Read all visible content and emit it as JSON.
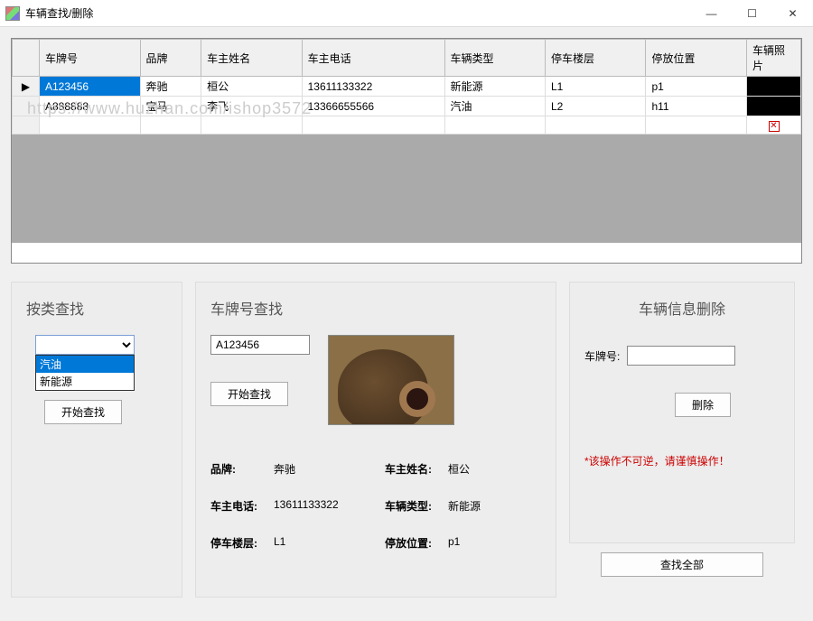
{
  "window": {
    "title": "车辆查找/删除"
  },
  "grid": {
    "columns": [
      "车牌号",
      "品牌",
      "车主姓名",
      "车主电话",
      "车辆类型",
      "停车楼层",
      "停放位置",
      "车辆照片"
    ],
    "rows": [
      {
        "plate": "A123456",
        "brand": "奔驰",
        "owner": "桓公",
        "phone": "13611133322",
        "type": "新能源",
        "floor": "L1",
        "pos": "p1"
      },
      {
        "plate": "A888888",
        "brand": "宝马",
        "owner": "李飞",
        "phone": "13366655566",
        "type": "汽油",
        "floor": "L2",
        "pos": "h11"
      }
    ]
  },
  "categorySearch": {
    "title": "按类查找",
    "options": [
      "汽油",
      "新能源"
    ],
    "buttonLabel": "开始查找"
  },
  "plateSearch": {
    "title": "车牌号查找",
    "inputValue": "A123456",
    "buttonLabel": "开始查找",
    "labels": {
      "brand": "品牌:",
      "owner": "车主姓名:",
      "phone": "车主电话:",
      "type": "车辆类型:",
      "floor": "停车楼层:",
      "pos": "停放位置:"
    },
    "values": {
      "brand": "奔驰",
      "owner": "桓公",
      "phone": "13611133322",
      "type": "新能源",
      "floor": "L1",
      "pos": "p1"
    }
  },
  "deletePanel": {
    "title": "车辆信息删除",
    "plateLabel": "车牌号:",
    "plateValue": "",
    "deleteButton": "删除",
    "warning": "*该操作不可逆，请谨慎操作！",
    "searchAllButton": "查找全部"
  },
  "watermark": "https://www.huzhan.com/ishop3572"
}
